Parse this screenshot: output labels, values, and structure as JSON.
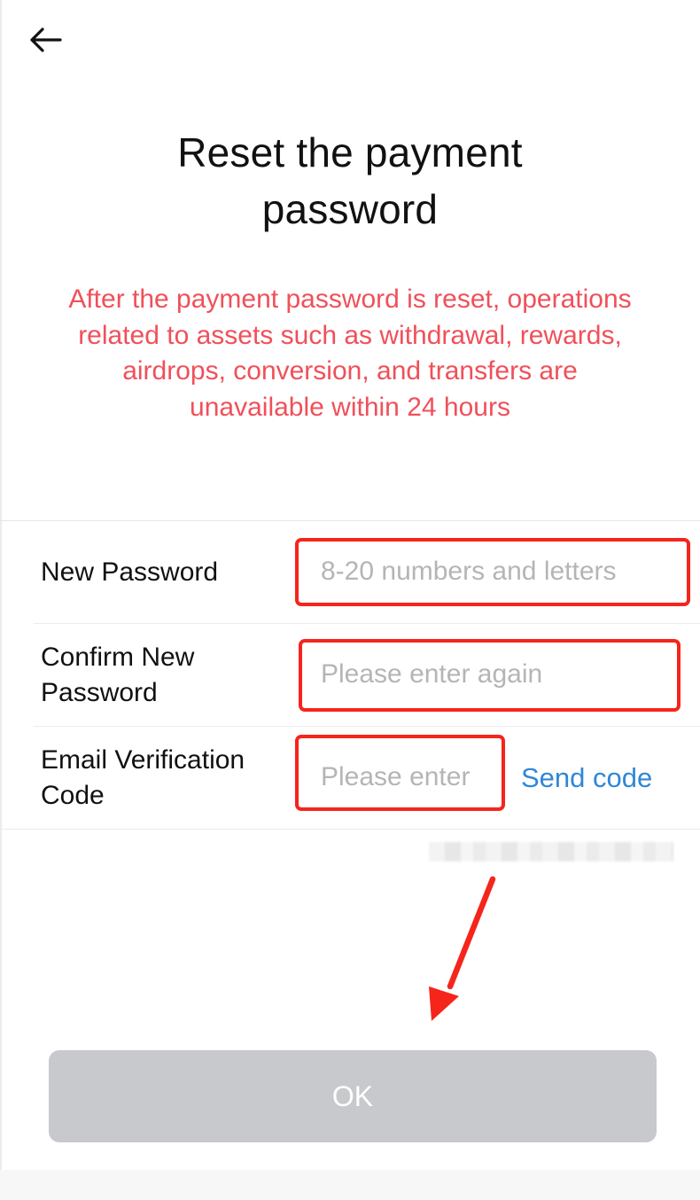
{
  "header": {
    "back_icon": "arrow-left-icon"
  },
  "title": "Reset the payment password",
  "warning": "After the payment password is reset, operations related to assets such as withdrawal, rewards, airdrops, conversion, and transfers are unavailable within 24 hours",
  "colors": {
    "warning": "#f0505a",
    "link": "#2f87d8",
    "annotation": "#f5251c",
    "button_disabled": "#c8c9cd"
  },
  "form": {
    "new_password": {
      "label": "New Password",
      "placeholder": "8-20 numbers and letters",
      "value": ""
    },
    "confirm_password": {
      "label": "Confirm New Password",
      "placeholder": "Please enter again",
      "value": ""
    },
    "email_code": {
      "label": "Email Verification Code",
      "placeholder": "Please enter",
      "value": "",
      "send_code_label": "Send code"
    }
  },
  "ok_button": {
    "label": "OK"
  }
}
